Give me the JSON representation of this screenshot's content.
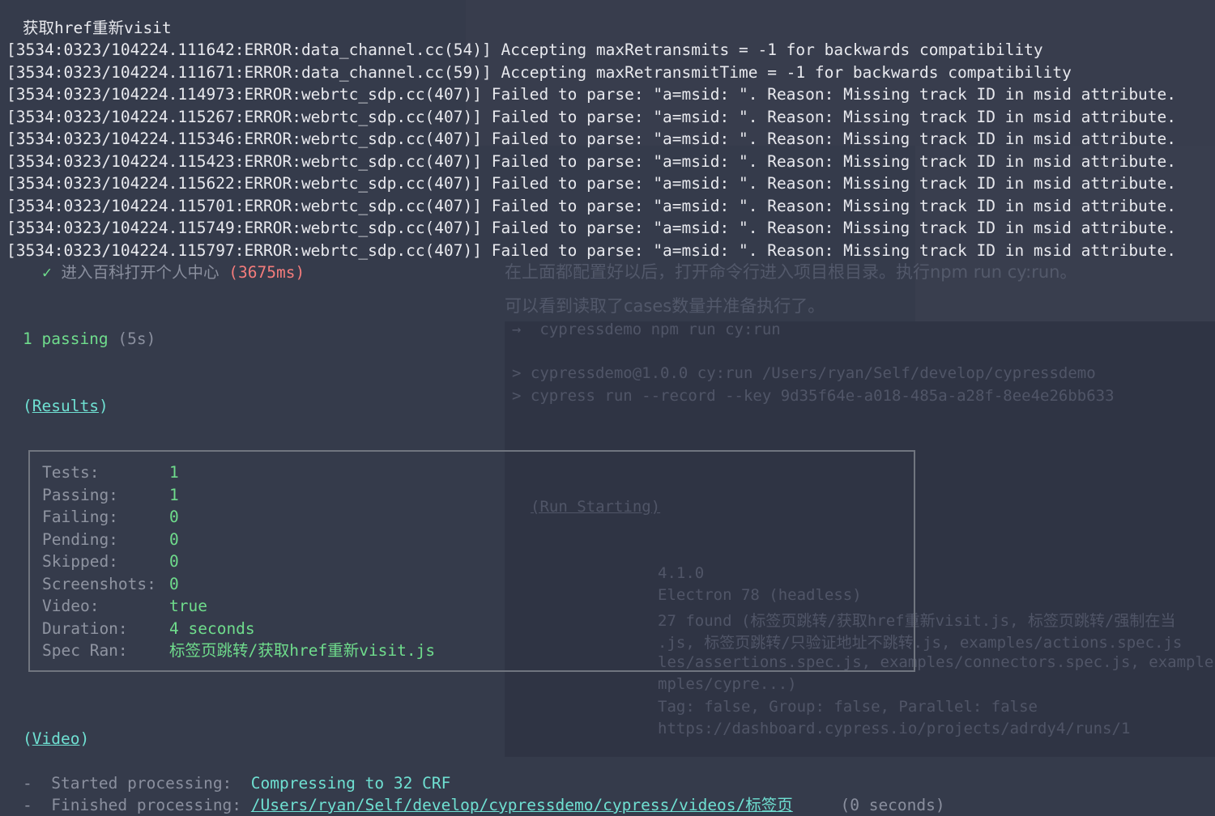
{
  "header_line": "获取href重新visit",
  "log_lines": [
    "[3534:0323/104224.111642:ERROR:data_channel.cc(54)] Accepting maxRetransmits = -1 for backwards compatibility",
    "[3534:0323/104224.111671:ERROR:data_channel.cc(59)] Accepting maxRetransmitTime = -1 for backwards compatibility",
    "[3534:0323/104224.114973:ERROR:webrtc_sdp.cc(407)] Failed to parse: \"a=msid: \". Reason: Missing track ID in msid attribute.",
    "[3534:0323/104224.115267:ERROR:webrtc_sdp.cc(407)] Failed to parse: \"a=msid: \". Reason: Missing track ID in msid attribute.",
    "[3534:0323/104224.115346:ERROR:webrtc_sdp.cc(407)] Failed to parse: \"a=msid: \". Reason: Missing track ID in msid attribute.",
    "[3534:0323/104224.115423:ERROR:webrtc_sdp.cc(407)] Failed to parse: \"a=msid: \". Reason: Missing track ID in msid attribute.",
    "[3534:0323/104224.115622:ERROR:webrtc_sdp.cc(407)] Failed to parse: \"a=msid: \". Reason: Missing track ID in msid attribute.",
    "[3534:0323/104224.115701:ERROR:webrtc_sdp.cc(407)] Failed to parse: \"a=msid: \". Reason: Missing track ID in msid attribute.",
    "[3534:0323/104224.115749:ERROR:webrtc_sdp.cc(407)] Failed to parse: \"a=msid: \". Reason: Missing track ID in msid attribute.",
    "[3534:0323/104224.115797:ERROR:webrtc_sdp.cc(407)] Failed to parse: \"a=msid: \". Reason: Missing track ID in msid attribute."
  ],
  "test_result": {
    "check": "✓",
    "title": "进入百科打开个人中心",
    "duration": "(3675ms)"
  },
  "passing": {
    "count_text": "1 passing",
    "time": "(5s)"
  },
  "results_heading": "Results",
  "results": [
    {
      "label": "Tests:",
      "value": "1"
    },
    {
      "label": "Passing:",
      "value": "1"
    },
    {
      "label": "Failing:",
      "value": "0"
    },
    {
      "label": "Pending:",
      "value": "0"
    },
    {
      "label": "Skipped:",
      "value": "0"
    },
    {
      "label": "Screenshots:",
      "value": "0"
    },
    {
      "label": "Video:",
      "value": "true"
    },
    {
      "label": "Duration:",
      "value": "4 seconds"
    },
    {
      "label": "Spec Ran:",
      "value": "标签页跳转/获取href重新visit.js"
    }
  ],
  "video_heading": "Video",
  "video_lines": [
    {
      "dash": "-",
      "label": "Started processing:",
      "value": "Compressing to 32 CRF",
      "extra": ""
    },
    {
      "dash": "-",
      "label": "Finished processing:",
      "value": "/Users/ryan/Self/develop/cypressdemo/cypress/videos/标签页",
      "extra": "(0 seconds)"
    }
  ],
  "ghost": {
    "para1": "在上面都配置好以后，打开命令行进入项目根目录。执行npm run cy:run。",
    "para2": "可以看到读取了cases数量并准备执行了。",
    "cmd0": "→  cypressdemo npm run cy:run",
    "cmd1": "> cypressdemo@1.0.0 cy:run /Users/ryan/Self/develop/cypressdemo",
    "cmd2": "> cypress run --record --key 9d35f64e-a018-485a-a28f-8ee4e26bb633",
    "run_starting": "(Run Starting)",
    "v1": "4.1.0",
    "v2": "Electron 78",
    "v2b": "(headless)",
    "v3": "27 found (标签页跳转/获取href重新visit.js, 标签页跳转/强制在当",
    "v4": ".js, 标签页跳转/只验证地址不跳转.js, examples/actions.spec.js",
    "v5": "les/assertions.spec.js, examples/connectors.spec.js, examples",
    "v6": "mples/cypre...)",
    "v7": "Tag: false, Group: false, Parallel: false",
    "v8": "https://dashboard.cypress.io/projects/adrdy4/runs/1"
  }
}
